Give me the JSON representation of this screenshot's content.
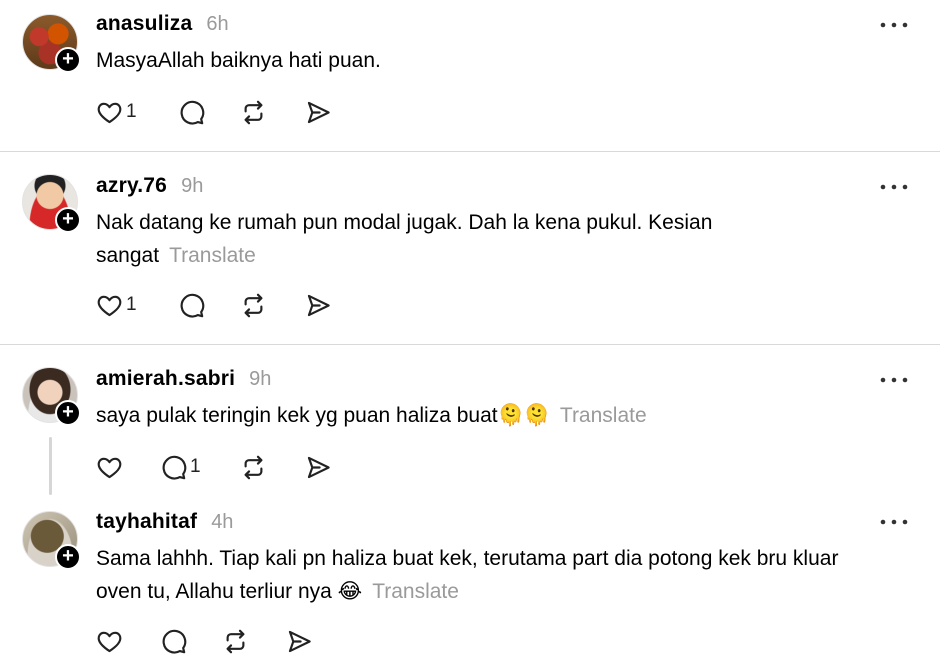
{
  "posts": [
    {
      "username": "anasuliza",
      "time": "6h",
      "text": "MasyaAllah baiknya hati puan.",
      "translate": "",
      "likes": "1",
      "replies": ""
    },
    {
      "username": "azry.76",
      "time": "9h",
      "text_line1": "Nak datang ke rumah pun modal jugak. Dah la kena pukul. Kesian",
      "text_line2": "sangat",
      "translate": "Translate",
      "likes": "1",
      "replies": ""
    },
    {
      "username": "amierah.sabri",
      "time": "9h",
      "text": "saya pulak teringin kek yg puan haliza buat🫠🫠",
      "translate": "Translate",
      "likes": "",
      "replies": "1"
    },
    {
      "username": "tayhahitaf",
      "time": "4h",
      "text_line1": "Sama lahhh. Tiap kali pn haliza buat kek, terutama part dia potong kek bru kluar",
      "text_line2": "oven tu, Allahu terliur nya 😂",
      "translate": "Translate",
      "likes": "",
      "replies": ""
    }
  ],
  "icons": {
    "follow": "plus-badge-icon",
    "more": "more-horizontal-icon",
    "like": "heart-icon",
    "reply": "reply-bubble-icon",
    "repost": "repost-icon",
    "share": "send-icon"
  },
  "badge_symbol": "+"
}
